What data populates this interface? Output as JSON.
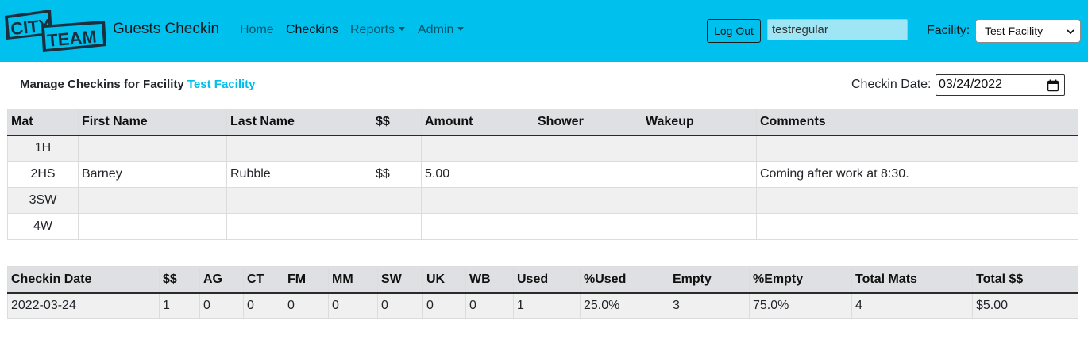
{
  "navbar": {
    "logo_text_top": "CITY",
    "logo_text_bottom": "TEAM",
    "brand": "Guests Checkin",
    "links": [
      {
        "label": "Home"
      },
      {
        "label": "Checkins"
      },
      {
        "label": "Reports"
      },
      {
        "label": "Admin"
      }
    ],
    "logout_label": "Log Out",
    "username": "testregular",
    "facility_label": "Facility:",
    "facility_selected": "Test Facility"
  },
  "colors": {
    "navbar_bg": "#00c0ee",
    "accent": "#00bde9",
    "header_row_bg": "#dfe0e3"
  },
  "heading": {
    "prefix": "Manage Checkins for Facility",
    "facility": "Test Facility"
  },
  "checkin_date": {
    "label": "Checkin Date:",
    "value": "03/24/2022"
  },
  "checkins": {
    "columns": [
      "Mat",
      "First Name",
      "Last Name",
      "$$",
      "Amount",
      "Shower",
      "Wakeup",
      "Comments"
    ],
    "rows": [
      {
        "mat": "1H",
        "first": "",
        "last": "",
        "paid": "",
        "amount": "",
        "shower": "",
        "wakeup": "",
        "comments": ""
      },
      {
        "mat": "2HS",
        "first": "Barney",
        "last": "Rubble",
        "paid": "$$",
        "amount": "5.00",
        "shower": "",
        "wakeup": "",
        "comments": "Coming after work at 8:30."
      },
      {
        "mat": "3SW",
        "first": "",
        "last": "",
        "paid": "",
        "amount": "",
        "shower": "",
        "wakeup": "",
        "comments": ""
      },
      {
        "mat": "4W",
        "first": "",
        "last": "",
        "paid": "",
        "amount": "",
        "shower": "",
        "wakeup": "",
        "comments": ""
      }
    ]
  },
  "summary": {
    "columns": [
      "Checkin Date",
      "$$",
      "AG",
      "CT",
      "FM",
      "MM",
      "SW",
      "UK",
      "WB",
      "Used",
      "%Used",
      "Empty",
      "%Empty",
      "Total Mats",
      "Total $$"
    ],
    "row": [
      "2022-03-24",
      "1",
      "0",
      "0",
      "0",
      "0",
      "0",
      "0",
      "0",
      "1",
      "25.0%",
      "3",
      "75.0%",
      "4",
      "$5.00"
    ]
  }
}
